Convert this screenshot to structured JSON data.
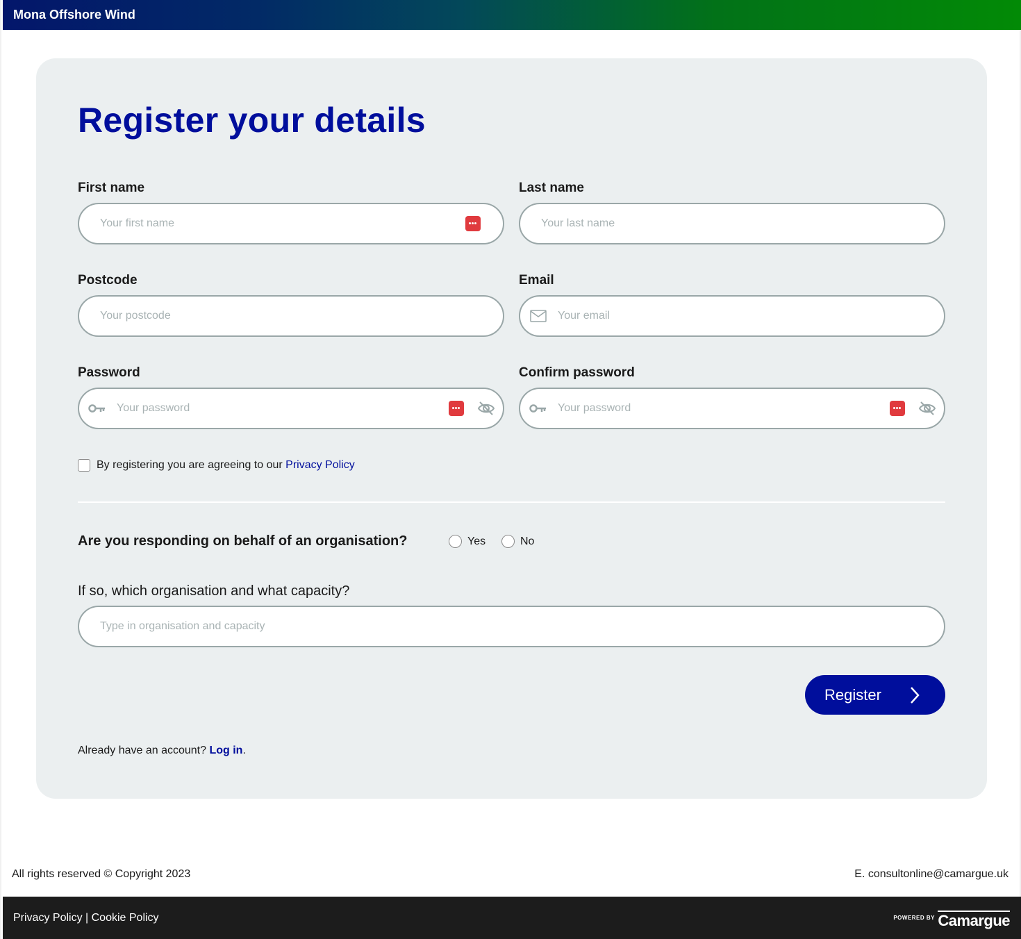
{
  "header": {
    "brand": "Mona Offshore Wind"
  },
  "form": {
    "title": "Register your details",
    "first_name": {
      "label": "First name",
      "placeholder": "Your first name"
    },
    "last_name": {
      "label": "Last name",
      "placeholder": "Your last name"
    },
    "postcode": {
      "label": "Postcode",
      "placeholder": "Your postcode"
    },
    "email": {
      "label": "Email",
      "placeholder": "Your email"
    },
    "password": {
      "label": "Password",
      "placeholder": "Your password"
    },
    "confirm_password": {
      "label": "Confirm password",
      "placeholder": "Your password"
    },
    "agree_text": "By registering you are agreeing to our ",
    "agree_link": "Privacy Policy",
    "organisation_question": "Are you responding on behalf of an organisation?",
    "radio_yes": "Yes",
    "radio_no": "No",
    "capacity_question": "If so, which organisation and what capacity?",
    "capacity_placeholder": "Type in organisation and capacity",
    "register_label": "Register",
    "already_text": "Already have an account? ",
    "login_link": "Log in",
    "login_suffix": "."
  },
  "page_footer": {
    "copyright": "All rights reserved © Copyright 2023",
    "contact": "E. consultonline@camargue.uk",
    "privacy_link": "Privacy Policy",
    "separator": " | ",
    "cookie_link": "Cookie Policy",
    "powered_by": "POWERED BY",
    "camargue": "Camargue"
  },
  "colors": {
    "accent": "#000e9c",
    "card_bg": "#ebeff0",
    "password_manager": "#e03a3e",
    "footer_bg": "#1c1c1c"
  },
  "icons": [
    "password-manager-icon",
    "mail-icon",
    "key-icon",
    "eye-off-icon",
    "chevron-right-icon"
  ]
}
